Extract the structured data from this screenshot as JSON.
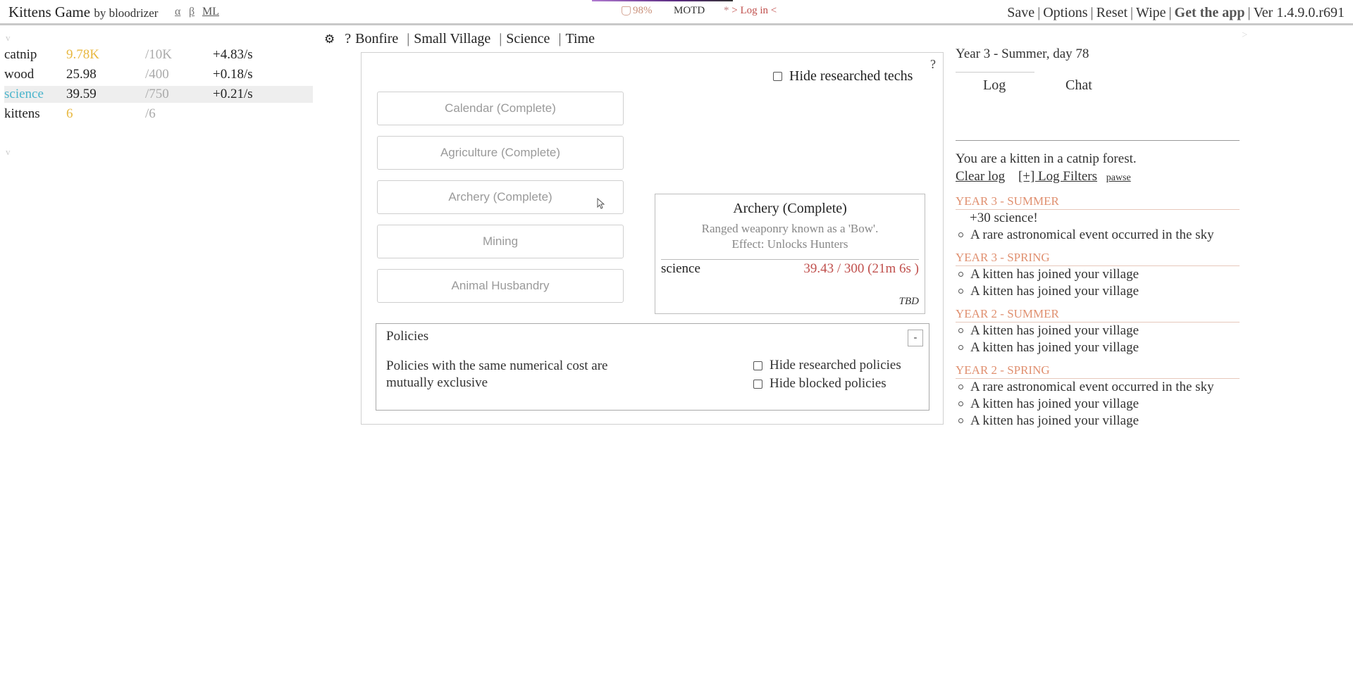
{
  "header": {
    "title": "Kittens Game",
    "author": "by bloodrizer",
    "links": [
      "α",
      "β",
      "ML"
    ],
    "happiness": "98%",
    "motd": "MOTD",
    "login_star": "*",
    "login": "> Log in <",
    "menu": [
      "Save",
      "Options",
      "Reset",
      "Wipe",
      "Get the app"
    ],
    "version": "Ver 1.4.9.0.r691"
  },
  "resources": {
    "collapse_glyph": "v",
    "rows": [
      {
        "name": "catnip",
        "amount": "9.78K",
        "max": "/10K",
        "rate": "+4.83/s",
        "amount_color": "#e8b840",
        "name_color": "#222"
      },
      {
        "name": "wood",
        "amount": "25.98",
        "max": "/400",
        "rate": "+0.18/s",
        "amount_color": "#222",
        "name_color": "#222"
      },
      {
        "name": "science",
        "amount": "39.59",
        "max": "/750",
        "rate": "+0.21/s",
        "amount_color": "#222",
        "name_color": "#4bb5cc",
        "highlighted": true
      },
      {
        "name": "kittens",
        "amount": "6",
        "max": "/6",
        "rate": "",
        "amount_color": "#e8b840",
        "name_color": "#222"
      }
    ],
    "collapse_glyph_2": "v"
  },
  "tabs": {
    "help": "?",
    "items": [
      "Bonfire",
      "Small Village",
      "Science",
      "Time"
    ],
    "separator": "|"
  },
  "science": {
    "help": "?",
    "hide_researched_label": "Hide researched techs",
    "techs": [
      "Calendar (Complete)",
      "Agriculture (Complete)",
      "Archery (Complete)",
      "Mining",
      "Animal Husbandry"
    ],
    "tooltip": {
      "title": "Archery (Complete)",
      "description": "Ranged weaponry known as a 'Bow'.",
      "effect": "Effect: Unlocks Hunters",
      "cost_resource": "science",
      "cost_value": "39.43 / 300 (21m 6s )",
      "footer": "TBD"
    },
    "policies": {
      "title": "Policies",
      "toggle": "-",
      "description": "Policies with the same numerical cost are mutually exclusive",
      "hide_researched": "Hide researched policies",
      "hide_blocked": "Hide blocked policies"
    }
  },
  "right": {
    "calendar": "Year 3 - Summer, day 78",
    "collapse_glyph": ">",
    "log_tabs": [
      "Log",
      "Chat"
    ],
    "intro": "You are a kitten in a catnip forest.",
    "clear_log": "Clear log",
    "log_filters": "[+] Log Filters",
    "pawse": "pawse",
    "log_groups": [
      {
        "header": "YEAR 3 - SUMMER",
        "entries": [
          {
            "text": "+30 science!",
            "bullet": false
          },
          {
            "text": "A rare astronomical event occurred in the sky",
            "bullet": true
          }
        ]
      },
      {
        "header": "YEAR 3 - SPRING",
        "entries": [
          {
            "text": "A kitten has joined your village",
            "bullet": true
          },
          {
            "text": "A kitten has joined your village",
            "bullet": true
          }
        ]
      },
      {
        "header": "YEAR 2 - SUMMER",
        "entries": [
          {
            "text": "A kitten has joined your village",
            "bullet": true
          },
          {
            "text": "A kitten has joined your village",
            "bullet": true
          }
        ]
      },
      {
        "header": "YEAR 2 - SPRING",
        "entries": [
          {
            "text": "A rare astronomical event occurred in the sky",
            "bullet": true
          },
          {
            "text": "A kitten has joined your village",
            "bullet": true
          },
          {
            "text": "A kitten has joined your village",
            "bullet": true
          }
        ]
      }
    ]
  }
}
